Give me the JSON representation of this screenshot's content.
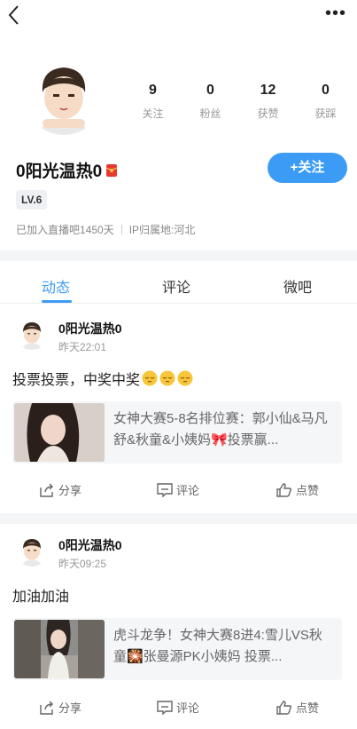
{
  "header": {
    "back_icon": "chevron-left-icon",
    "more_icon": "more-dots-icon",
    "more_glyph": "•••"
  },
  "profile": {
    "name": "0阳光温热0",
    "level": "LV.6",
    "joined": "已加入直播吧1450天",
    "ip": "IP归属地:河北",
    "follow_label": "+关注",
    "stats": [
      {
        "num": "9",
        "label": "关注"
      },
      {
        "num": "0",
        "label": "粉丝"
      },
      {
        "num": "12",
        "label": "获赞"
      },
      {
        "num": "0",
        "label": "获踩"
      }
    ]
  },
  "tabs": [
    {
      "label": "动态",
      "active": true
    },
    {
      "label": "评论",
      "active": false
    },
    {
      "label": "微吧",
      "active": false
    }
  ],
  "posts": [
    {
      "user": "0阳光温热0",
      "time": "昨天22:01",
      "text": "投票投票，中奖中奖",
      "card_text": "女神大赛5-8名排位赛：郭小仙&马凡舒&秋童&小姨妈🎀投票赢...",
      "share": "分享",
      "comment": "评论",
      "like": "点赞"
    },
    {
      "user": "0阳光温热0",
      "time": "昨天09:25",
      "text": "加油加油",
      "card_text": "虎斗龙争！女神大赛8进4:雪儿VS秋童🎇张曼源PK小姨妈 投票...",
      "share": "分享",
      "comment": "评论",
      "like": "点赞"
    }
  ],
  "colors": {
    "accent": "#3c9cf5",
    "muted": "#999999",
    "divider": "#f4f5f7"
  }
}
